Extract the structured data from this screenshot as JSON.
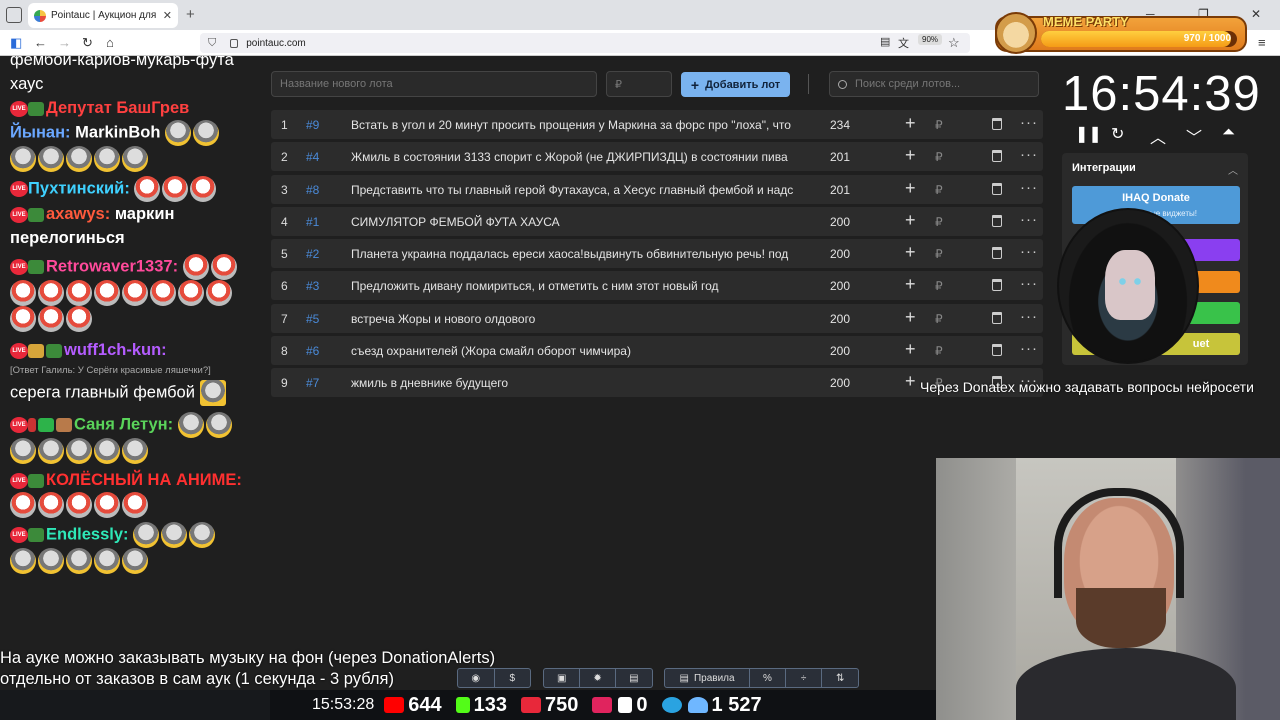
{
  "browser": {
    "tab_title": "Pointauc | Аукцион для стриме",
    "url": "pointauc.com",
    "zoom": "90%"
  },
  "overlay": {
    "meme_title": "MEME PARTY",
    "meme_count": "970 / 1000",
    "meme_progress": 0.97
  },
  "chat": {
    "lines": [
      {
        "text": "фембой-кариов-мукарь-фута хаус"
      },
      {
        "nick": "Депутат БашГрев",
        "nick_color": "#ff4040"
      },
      {
        "nick": "Йынан:",
        "nick_color": "#6aa7ff",
        "text": "MarkinBoh"
      },
      {
        "nick": "Пухтинский:",
        "nick_color": "#3fd1ff"
      },
      {
        "nick": "axawys:",
        "nick_color": "#ff5a3c",
        "text": "маркин перелогиньcя"
      },
      {
        "nick": "Retrowaver1337:",
        "nick_color": "#ff4a9b"
      },
      {
        "nick": "wuff1ch-kun:",
        "nick_color": "#b45cff"
      },
      {
        "reply": "[Ответ Галиль: У Серёги красивые ляшечки?]"
      },
      {
        "text": "серега главный фембой"
      },
      {
        "nick": "Саня Летун:",
        "nick_color": "#5ad35a"
      },
      {
        "nick": "КОЛЁСНЫЙ НА АНИМЕ:",
        "nick_color": "#ff3030"
      },
      {
        "nick": "Endlessly:",
        "nick_color": "#2ee8b8"
      }
    ]
  },
  "auction": {
    "new_lot_placeholder": "Название нового лота",
    "amount_placeholder": "₽",
    "add_button": "Добавить лот",
    "search_placeholder": "Поиск среди лотов...",
    "lots": [
      {
        "index": "1",
        "code": "#9",
        "name": "Встать в угол и 20 минут просить прощения у Маркина за форс про \"лоха\", что",
        "amount": "234"
      },
      {
        "index": "2",
        "code": "#4",
        "name": "Жмиль в состоянии 3133 спорит с Жорой (не ДЖИРПИЗДЦ) в состоянии пива",
        "amount": "201"
      },
      {
        "index": "3",
        "code": "#8",
        "name": "Представить что ты главный герой Футахауса, а Хесус главный фембой и надс",
        "amount": "201"
      },
      {
        "index": "4",
        "code": "#1",
        "name": "СИМУЛЯТОР ФЕМБОЙ ФУТА ХАУСА",
        "amount": "200"
      },
      {
        "index": "5",
        "code": "#2",
        "name": "Планета украина поддалась ереси хаоса!выдвинуть обвинительную речь! под",
        "amount": "200"
      },
      {
        "index": "6",
        "code": "#3",
        "name": "Предложить дивану помириться, и отметить с ним этот новый год",
        "amount": "200"
      },
      {
        "index": "7",
        "code": "#5",
        "name": "встреча Жоры и нового олдового",
        "amount": "200"
      },
      {
        "index": "8",
        "code": "#6",
        "name": "съезд охранителей (Жора смайл оборот чимчира)",
        "amount": "200"
      },
      {
        "index": "9",
        "code": "#7",
        "name": "жмиль в дневнике будущего",
        "amount": "200"
      }
    ],
    "rub_symbol": "₽"
  },
  "timer": {
    "time": "16:54:39"
  },
  "integrations": {
    "title": "Интеграции",
    "ihaq_label": "IHAQ Donate",
    "ihaq_sub": "Уникальные виджеты!",
    "last_label": "uet",
    "colors": [
      "#8a3ff0",
      "#f08a1c",
      "#39c24a",
      "#c7c43a"
    ]
  },
  "ticker": {
    "donatex": "Через Donatex можно задавать вопросы нейросети"
  },
  "bottom": {
    "music_line1": "На ауке можно заказывать музыку на фон (через DonationAlerts)",
    "music_line2": "отдельно от заказов в сам аук (1 секунда - 3 рубля)",
    "rules_label": "Правила",
    "percent_label": "%",
    "clock": "15:53:28",
    "youtube": "644",
    "kick": "133",
    "vkplay": "750",
    "rutube": "0",
    "telegram": "",
    "viewers": "1 527"
  }
}
